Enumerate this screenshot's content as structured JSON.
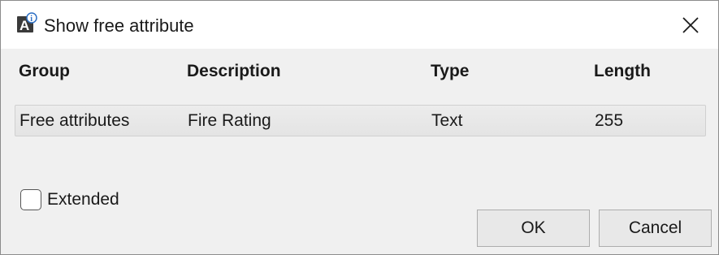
{
  "window": {
    "title": "Show free attribute",
    "icon": "attribute-info-icon"
  },
  "table": {
    "columns": [
      "Group",
      "Description",
      "Type",
      "Length"
    ],
    "rows": [
      [
        "Free attributes",
        "Fire Rating",
        "Text",
        "255"
      ]
    ]
  },
  "options": {
    "extended_label": "Extended",
    "extended_checked": false
  },
  "buttons": {
    "ok_label": "OK",
    "cancel_label": "Cancel"
  },
  "colors": {
    "dialog_bg": "#f0f0f0",
    "titlebar_bg": "#ffffff",
    "row_bg": "#e8e8e8"
  }
}
